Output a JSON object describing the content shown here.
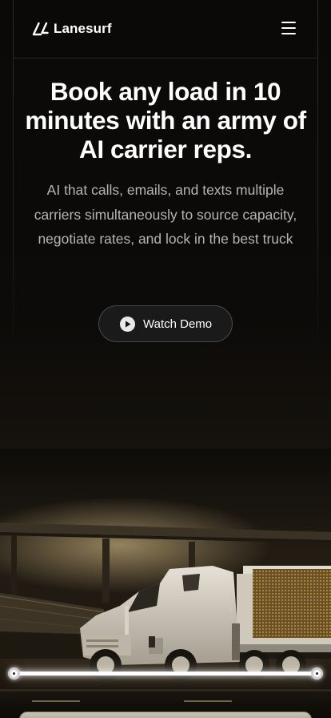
{
  "brand": {
    "name": "Lanesurf",
    "logo_icon": "lanesurf-logo-icon"
  },
  "header": {
    "menu_icon": "hamburger-menu-icon"
  },
  "hero": {
    "title": "Book any load in 10 minutes with an army of AI carrier reps.",
    "subtitle": "AI that calls, emails, and texts multiple carriers simultaneously to source capacity, negotiate rates, and lock in the best truck"
  },
  "cta": {
    "watch_demo_label": "Watch Demo",
    "icon": "play-icon"
  },
  "colors": {
    "background": "#050505",
    "text_primary": "#ffffff",
    "text_secondary": "#b4b4b4",
    "button_bg": "#1a1a1a",
    "button_border": "#484848"
  }
}
